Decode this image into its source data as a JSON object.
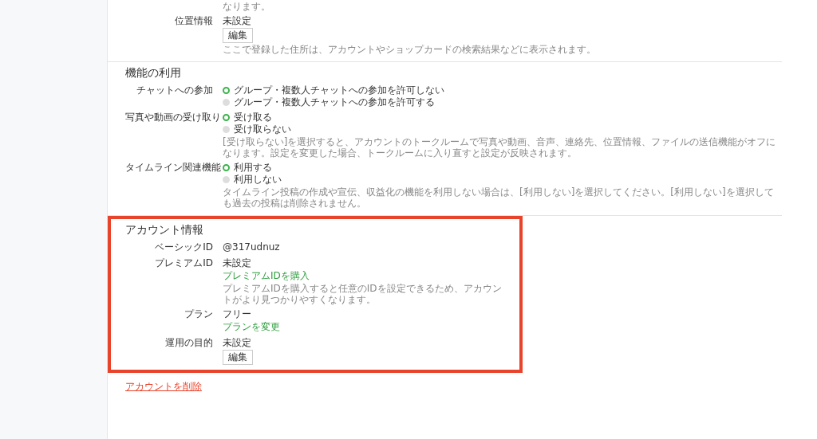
{
  "top": {
    "note_tail": "なります。",
    "rows": [
      {
        "label": "位置情報",
        "value": "未設定",
        "button": "編集",
        "note": "ここで登録した住所は、アカウントやショップカードの検索結果などに表示されます。"
      }
    ]
  },
  "sections": [
    {
      "title": "機能の利用",
      "highlighted": false,
      "rows": [
        {
          "kind": "radio",
          "label": "チャットへの参加",
          "options": [
            {
              "label": "グループ・複数人チャットへの参加を許可しない",
              "selected": true
            },
            {
              "label": "グループ・複数人チャットへの参加を許可する",
              "selected": false
            }
          ]
        },
        {
          "kind": "radio",
          "label": "写真や動画の受け取り",
          "options": [
            {
              "label": "受け取る",
              "selected": true
            },
            {
              "label": "受け取らない",
              "selected": false
            }
          ],
          "note": "[受け取らない]を選択すると、アカウントのトークルームで写真や動画、音声、連絡先、位置情報、ファイルの送信機能がオフになります。設定を変更した場合、トークルームに入り直すと設定が反映されます。"
        },
        {
          "kind": "radio",
          "label": "タイムライン関連機能",
          "options": [
            {
              "label": "利用する",
              "selected": true
            },
            {
              "label": "利用しない",
              "selected": false
            }
          ],
          "note": "タイムライン投稿の作成や宣伝、収益化の機能を利用しない場合は、[利用しない]を選択してください。[利用しない]を選択しても過去の投稿は削除されません。"
        }
      ]
    },
    {
      "title": "アカウント情報",
      "highlighted": true,
      "rows": [
        {
          "kind": "text",
          "label": "ベーシックID",
          "value": "@317udnuz"
        },
        {
          "kind": "text",
          "label": "プレミアムID",
          "value": "未設定",
          "link": "プレミアムIDを購入",
          "note": "プレミアムIDを購入すると任意のIDを設定できるため、アカウントがより見つかりやすくなります。"
        },
        {
          "kind": "text",
          "label": "プラン",
          "value": "フリー",
          "link": "プランを変更"
        },
        {
          "kind": "text",
          "label": "運用の目的",
          "value": "未設定",
          "button": "編集"
        }
      ]
    }
  ],
  "delete_link": "アカウントを削除"
}
